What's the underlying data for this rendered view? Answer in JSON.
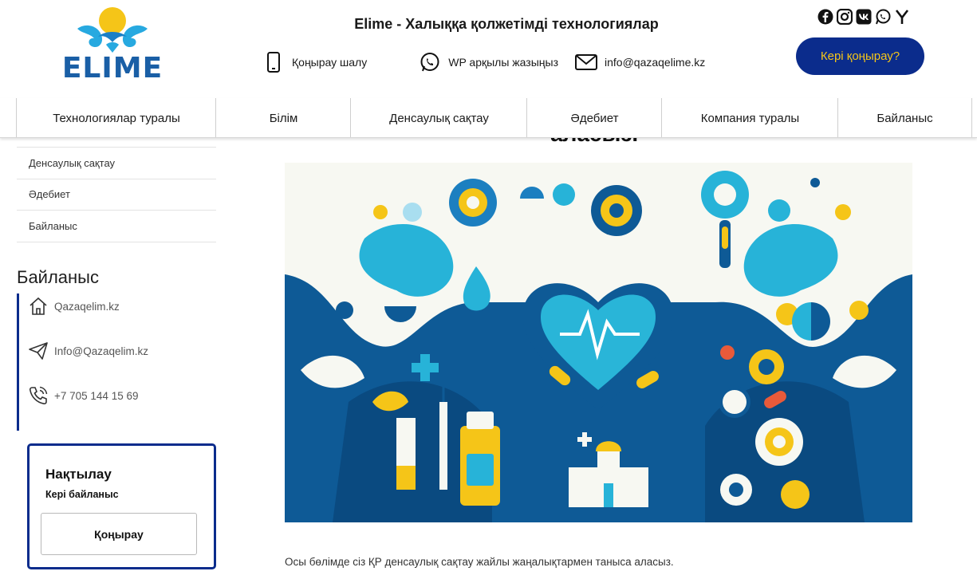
{
  "header": {
    "logo_text": "ELIME",
    "site_title": "Elime - Халыққа қолжетімді технологиялар",
    "contacts": [
      {
        "icon": "phone-icon",
        "label": "Қоңырау шалу"
      },
      {
        "icon": "whatsapp-icon",
        "label": "WP арқылы жазыңыз"
      },
      {
        "icon": "mail-icon",
        "label": "info@qazaqelime.kz"
      }
    ],
    "socials": [
      "facebook-icon",
      "instagram-icon",
      "vk-icon",
      "whatsapp-icon",
      "yandex-icon"
    ],
    "callback_label": "Кері қоңырау?"
  },
  "nav": {
    "items": [
      {
        "label": "Технологиялар туралы"
      },
      {
        "label": "Білім"
      },
      {
        "label": "Денсаулық сақтау"
      },
      {
        "label": "Әдебиет"
      },
      {
        "label": "Компания туралы"
      },
      {
        "label": "Байланыс"
      }
    ]
  },
  "sidebar": {
    "menu": [
      {
        "label": "Денсаулық сақтау"
      },
      {
        "label": "Әдебиет"
      },
      {
        "label": "Байланыс"
      }
    ],
    "contact_heading": "Байланыс",
    "contacts": [
      {
        "icon": "home-icon",
        "label": "Qazaqelim.kz"
      },
      {
        "icon": "send-icon",
        "label": "Info@Qazaqelim.kz"
      },
      {
        "icon": "phone-call-icon",
        "label": "+7 705 144 15 69"
      }
    ],
    "clarify": {
      "title": "Нақтылау",
      "subtitle": "Кері байланыс",
      "button": "Қоңырау"
    }
  },
  "main": {
    "heading_fragment": "аласыз.",
    "hero_image": "healthcare-illustration",
    "body_text": "Осы бөлімде сіз ҚР денсаулық сақтау жайлы жаңалықтармен таныса аласыз."
  },
  "colors": {
    "brand_blue": "#0b2c8c",
    "brand_yellow": "#f5c518",
    "logo_blue": "#1a5fa6",
    "teal": "#27b3d8"
  }
}
